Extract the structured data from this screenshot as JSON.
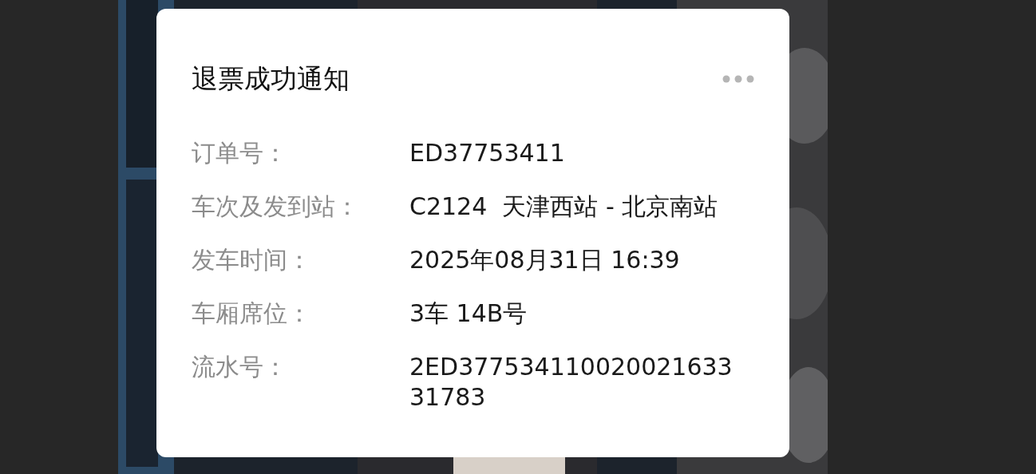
{
  "card": {
    "title": "退票成功通知",
    "rows": [
      {
        "label": "订单号：",
        "value": "ED37753411"
      },
      {
        "label": "车次及发到站：",
        "value": "C2124  天津西站 - 北京南站"
      },
      {
        "label": "发车时间：",
        "value": "2025年08月31日 16:39"
      },
      {
        "label": "车厢席位：",
        "value": "3车 14B号"
      },
      {
        "label": "流水号：",
        "value": "2ED37753411002002163331783"
      }
    ]
  }
}
